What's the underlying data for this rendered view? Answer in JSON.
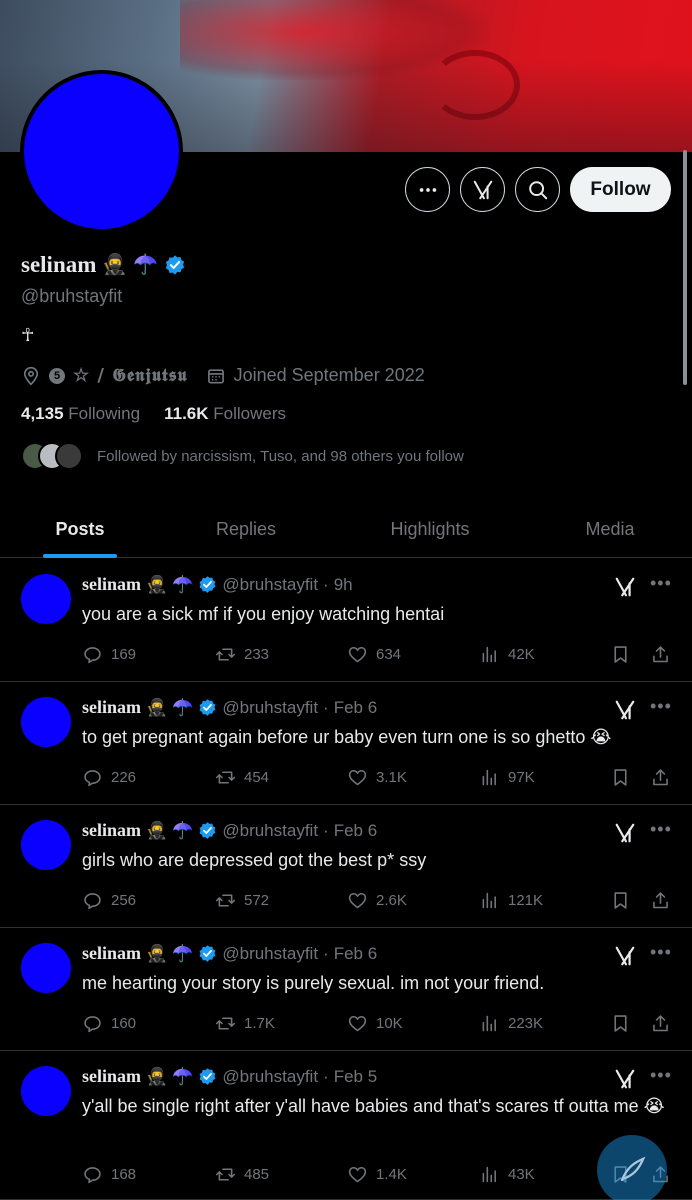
{
  "profile": {
    "display_name": "selinam",
    "name_emojis": [
      "🥷",
      "☂️"
    ],
    "handle": "@bruhstayfit",
    "bio": "☥",
    "location_prefix": "5",
    "location": "☆ / 𝕲𝖊𝖓𝖏𝖚𝖙𝖘𝖚",
    "joined": "Joined September 2022",
    "following_count": "4,135",
    "following_label": "Following",
    "followers_count": "11.6K",
    "followers_label": "Followers",
    "followed_by": "Followed by narcissism, Tuso, and 98 others you follow"
  },
  "actions": {
    "follow_label": "Follow"
  },
  "tabs": [
    "Posts",
    "Replies",
    "Highlights",
    "Media"
  ],
  "posts": [
    {
      "name": "selinam",
      "handle": "@bruhstayfit",
      "time": "9h",
      "text": "you are a sick mf if you enjoy watching hentai",
      "replies": "169",
      "reposts": "233",
      "likes": "634",
      "views": "42K"
    },
    {
      "name": "selinam",
      "handle": "@bruhstayfit",
      "time": "Feb 6",
      "text": "to get pregnant again before ur baby even turn one is so ghetto 😭",
      "replies": "226",
      "reposts": "454",
      "likes": "3.1K",
      "views": "97K"
    },
    {
      "name": "selinam",
      "handle": "@bruhstayfit",
      "time": "Feb 6",
      "text": "girls who are depressed got the best p* ssy",
      "replies": "256",
      "reposts": "572",
      "likes": "2.6K",
      "views": "121K"
    },
    {
      "name": "selinam",
      "handle": "@bruhstayfit",
      "time": "Feb 6",
      "text": "me hearting your story is purely sexual. im not your friend.",
      "replies": "160",
      "reposts": "1.7K",
      "likes": "10K",
      "views": "223K"
    },
    {
      "name": "selinam",
      "handle": "@bruhstayfit",
      "time": "Feb 5",
      "text": "y'all be single right after y'all have babies and that's scares tf outta me 😭",
      "replies": "168",
      "reposts": "485",
      "likes": "1.4K",
      "views": "43K"
    }
  ],
  "colors": {
    "accent": "#1d9bf0",
    "avatar": "#0a00ff",
    "muted_text": "#71767b",
    "background": "#000000"
  },
  "icons": {
    "header_buttons": [
      "more-icon",
      "grok-icon",
      "search-icon"
    ],
    "post_actions": [
      "reply-icon",
      "repost-icon",
      "like-icon",
      "views-icon",
      "bookmark-icon",
      "share-icon"
    ],
    "fab": "compose-icon"
  }
}
